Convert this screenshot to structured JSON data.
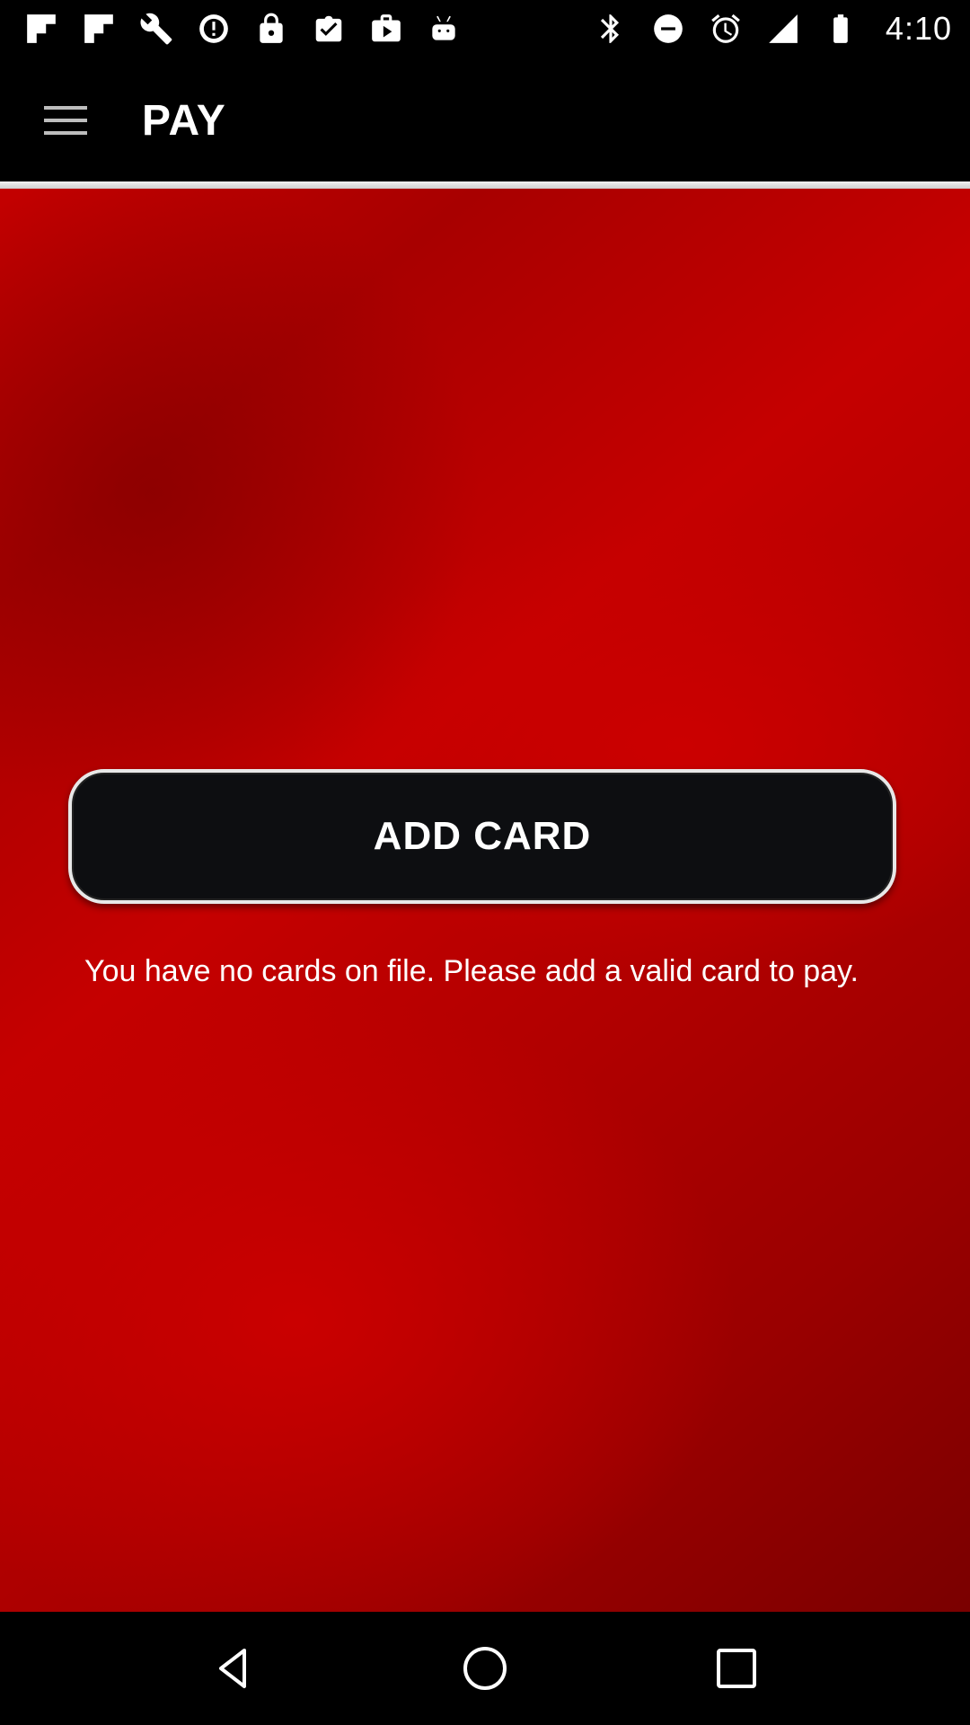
{
  "status_bar": {
    "time": "4:10",
    "left_icons": [
      "flipboard-icon",
      "flipboard-icon",
      "wrench-icon",
      "sync-icon",
      "lock-icon",
      "clipboard-icon",
      "play-store-icon",
      "android-icon"
    ],
    "right_icons": [
      "bluetooth-icon",
      "do-not-disturb-icon",
      "alarm-icon",
      "signal-icon",
      "battery-icon"
    ]
  },
  "app_bar": {
    "title": "PAY",
    "menu_icon": "menu-icon"
  },
  "main": {
    "add_card_label": "ADD CARD",
    "no_cards_message": "You have no cards on file. Please add a valid card to pay."
  },
  "nav_bar": {
    "buttons": [
      "back-icon",
      "home-icon",
      "recents-icon"
    ]
  },
  "colors": {
    "background_red": "#c30000",
    "button_dark": "#0d0e11",
    "bar_black": "#000000",
    "text_white": "#ffffff"
  }
}
